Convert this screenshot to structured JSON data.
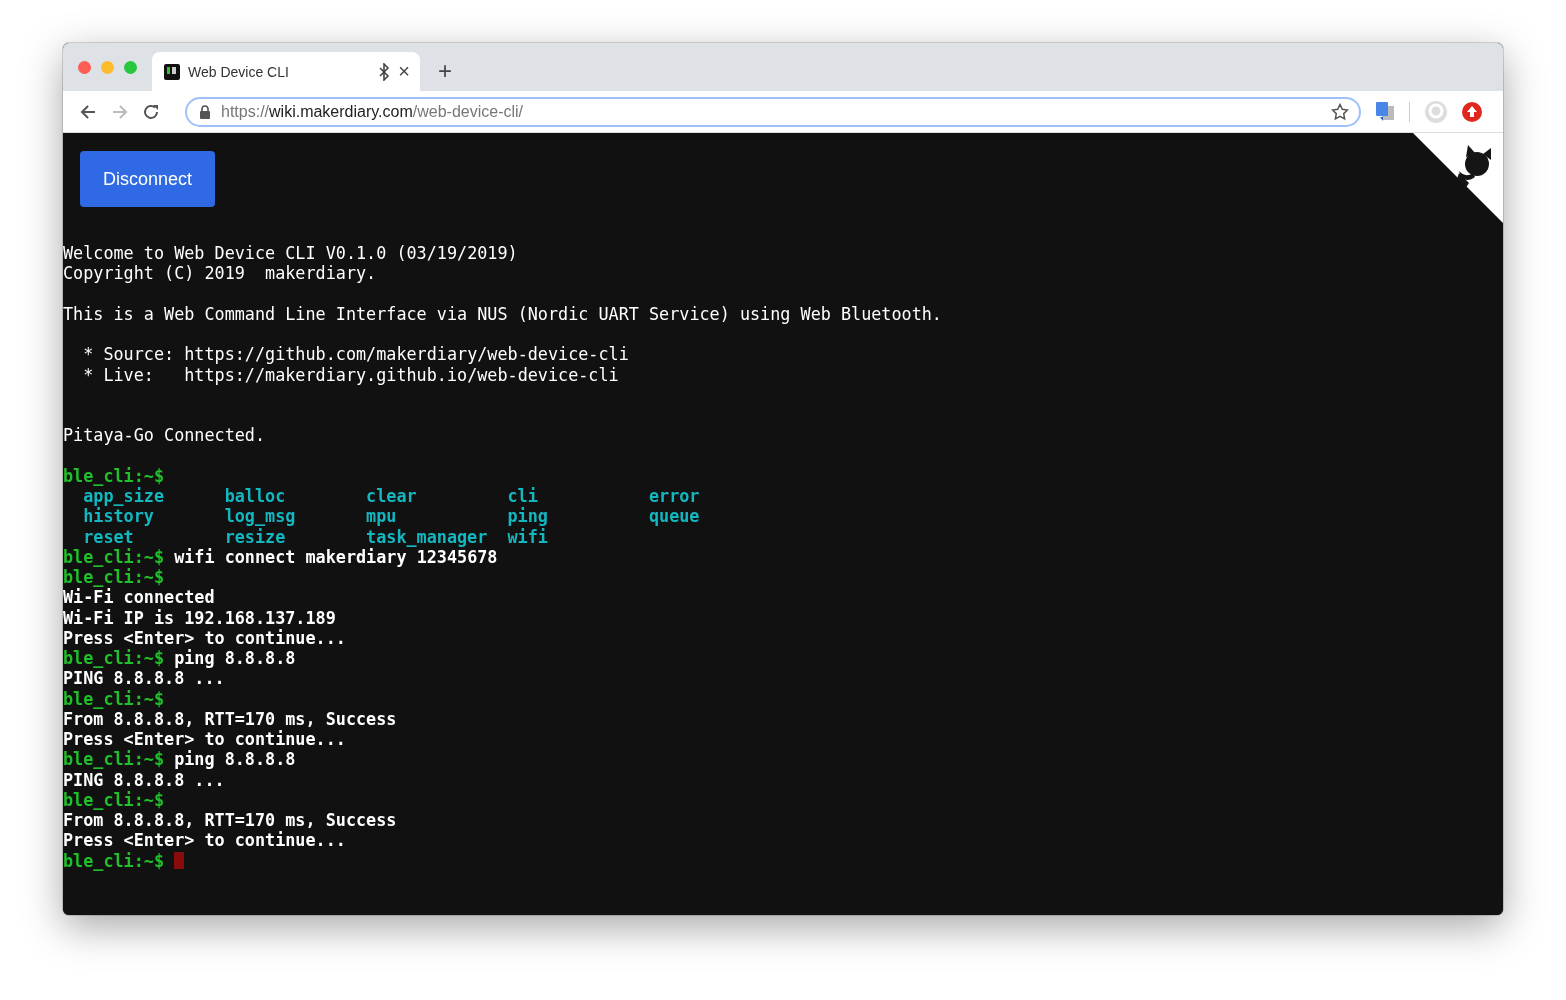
{
  "tabs": [
    {
      "title": "Web Device CLI",
      "selected": true,
      "bluetooth": true,
      "close": "×"
    }
  ],
  "new_tab": "+",
  "address_bar": {
    "scheme": "https://",
    "host": "wiki.makerdiary.com",
    "path": "/web-device-cli/",
    "secure": true,
    "bookmarked": false
  },
  "page": {
    "button": "Disconnect",
    "terminal": [
      {
        "kind": "text",
        "text": "Welcome to Web Device CLI V0.1.0 (03/19/2019)",
        "bold": false
      },
      {
        "kind": "text",
        "text": "Copyright (C) 2019  makerdiary.",
        "bold": false
      },
      {
        "kind": "blank"
      },
      {
        "kind": "text",
        "text": "This is a Web Command Line Interface via NUS (Nordic UART Service) using Web Bluetooth.",
        "bold": false
      },
      {
        "kind": "blank"
      },
      {
        "kind": "text",
        "text": "  * Source: https://github.com/makerdiary/web-device-cli",
        "bold": false
      },
      {
        "kind": "text",
        "text": "  * Live:   https://makerdiary.github.io/web-device-cli",
        "bold": false
      },
      {
        "kind": "blank"
      },
      {
        "kind": "blank"
      },
      {
        "kind": "text",
        "text": "Pitaya-Go Connected.",
        "bold": false
      },
      {
        "kind": "blank"
      },
      {
        "kind": "prompt",
        "prompt": "ble_cli:~$",
        "cursor": false
      },
      {
        "kind": "commands",
        "items": [
          "app_size",
          "balloc",
          "clear",
          "cli",
          "error"
        ]
      },
      {
        "kind": "commands",
        "items": [
          "history",
          "log_msg",
          "mpu",
          "ping",
          "queue"
        ]
      },
      {
        "kind": "commands",
        "items": [
          "reset",
          "resize",
          "task_manager",
          "wifi"
        ]
      },
      {
        "kind": "prompt",
        "prompt": "ble_cli:~$",
        "command": "wifi connect makerdiary 12345678",
        "cursor": false
      },
      {
        "kind": "prompt",
        "prompt": "ble_cli:~$",
        "cursor": false
      },
      {
        "kind": "text",
        "text": "Wi-Fi connected",
        "bold": true
      },
      {
        "kind": "text",
        "text": "Wi-Fi IP is 192.168.137.189",
        "bold": true
      },
      {
        "kind": "text",
        "text": "Press <Enter> to continue...",
        "bold": true
      },
      {
        "kind": "prompt",
        "prompt": "ble_cli:~$",
        "command": "ping 8.8.8.8",
        "cursor": false
      },
      {
        "kind": "text",
        "text": "PING 8.8.8.8 ...",
        "bold": true
      },
      {
        "kind": "prompt",
        "prompt": "ble_cli:~$",
        "cursor": false
      },
      {
        "kind": "text",
        "text": "From 8.8.8.8, RTT=170 ms, Success",
        "bold": true
      },
      {
        "kind": "text",
        "text": "Press <Enter> to continue...",
        "bold": true
      },
      {
        "kind": "prompt",
        "prompt": "ble_cli:~$",
        "command": "ping 8.8.8.8",
        "cursor": false
      },
      {
        "kind": "text",
        "text": "PING 8.8.8.8 ...",
        "bold": true
      },
      {
        "kind": "prompt",
        "prompt": "ble_cli:~$",
        "cursor": false
      },
      {
        "kind": "text",
        "text": "From 8.8.8.8, RTT=170 ms, Success",
        "bold": true
      },
      {
        "kind": "text",
        "text": "Press <Enter> to continue...",
        "bold": true
      },
      {
        "kind": "prompt",
        "prompt": "ble_cli:~$",
        "cursor": true
      }
    ]
  }
}
